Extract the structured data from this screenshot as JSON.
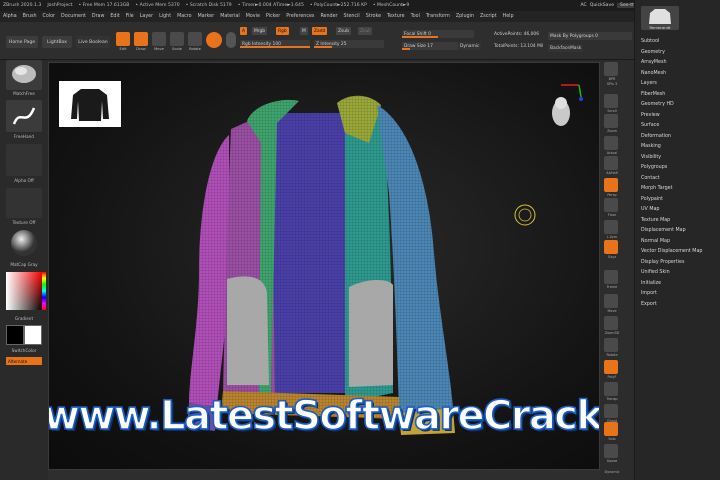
{
  "titlebar": {
    "items": [
      "ZBrush 2020.1.3",
      "JoshProject",
      "• Free Mem 17.613GB",
      "• Active Mem 5370",
      "• Scratch Disk 5179",
      "• Timer►0.004 ATime►1.645",
      "• PolyCount►252.716 KP",
      "• MeshCount►9"
    ],
    "ac": "AC",
    "quicksave": "QuickSave",
    "seethrough": "See-through  0",
    "menus": "Menus",
    "script": "DefaultZScript"
  },
  "menubar": [
    "Alpha",
    "Brush",
    "Color",
    "Document",
    "Draw",
    "Edit",
    "File",
    "Layer",
    "Light",
    "Macro",
    "Marker",
    "Material",
    "Movie",
    "Picker",
    "Preferences",
    "Render",
    "Stencil",
    "Stroke",
    "Texture",
    "Tool",
    "Transform",
    "Zplugin",
    "Zscript",
    "Help"
  ],
  "toolbar": {
    "home_page": "Home Page",
    "lightbox": "LightBox",
    "live_boolean": "Live Boolean",
    "edit": "Edit",
    "draw": "Draw",
    "move": "Move",
    "scale": "Scale",
    "rotate": "Rotate",
    "a": "A",
    "mrgb": "Mrgb",
    "rgb": "Rgb",
    "m": "M",
    "zadd": "Zadd",
    "zsub": "Zsub",
    "zcut": "Zcut",
    "rgb_intensity": "Rgb Intensity 100",
    "z_intensity": "Z Intensity 25",
    "focal_shift": "Focal Shift 0",
    "draw_size": "Draw Size 17",
    "dynamic": "Dynamic",
    "active_points": "ActivePoints: 46,006",
    "total_points": "TotalPoints: 13.104 Mil",
    "mask_by_polygroups": "Mask By Polygroups 0",
    "backface_mask": "BackfaceMask"
  },
  "leftpanel": {
    "matcap_label": "MatchFree",
    "freehand_label": "FreeHand",
    "alpha_off": "Alpha Off",
    "texture_off": "Texture Off",
    "material_label": "MatCap Gray",
    "gradient": "Gradient",
    "switch_color": "SwitchColor",
    "alternate": "Alternate"
  },
  "rightstrip": {
    "labels": [
      "BPR",
      "SPix 3",
      "Scroll",
      "Zoom",
      "Actual",
      "AAHalf",
      "Persp",
      "Floor",
      "L.Sym",
      "Gxyz",
      "Frame",
      "Move",
      "Zoom3D",
      "Rotate",
      "PolyF",
      "Transp",
      "Ghost",
      "Solo",
      "Xpose",
      "Dynamic"
    ]
  },
  "palette": {
    "header": "Rembrandt",
    "items": [
      "Subtool",
      "Geometry",
      "ArrayMesh",
      "NanoMesh",
      "Layers",
      "FiberMesh",
      "Geometry HD",
      "Preview",
      "Surface",
      "Deformation",
      "Masking",
      "Visibility",
      "Polygroups",
      "Contact",
      "Morph Target",
      "Polypaint",
      "UV Map",
      "Texture Map",
      "Displacement Map",
      "Normal Map",
      "Vector Displacement Map",
      "Display Properties",
      "Unified Skin",
      "Initialize",
      "Import",
      "Export"
    ]
  },
  "watermark": "www.LatestSoftwareCrack.com",
  "colors": {
    "accent": "#e8731a",
    "watermark_fill": "#ffffff",
    "watermark_stroke": "#1d5fc4"
  }
}
